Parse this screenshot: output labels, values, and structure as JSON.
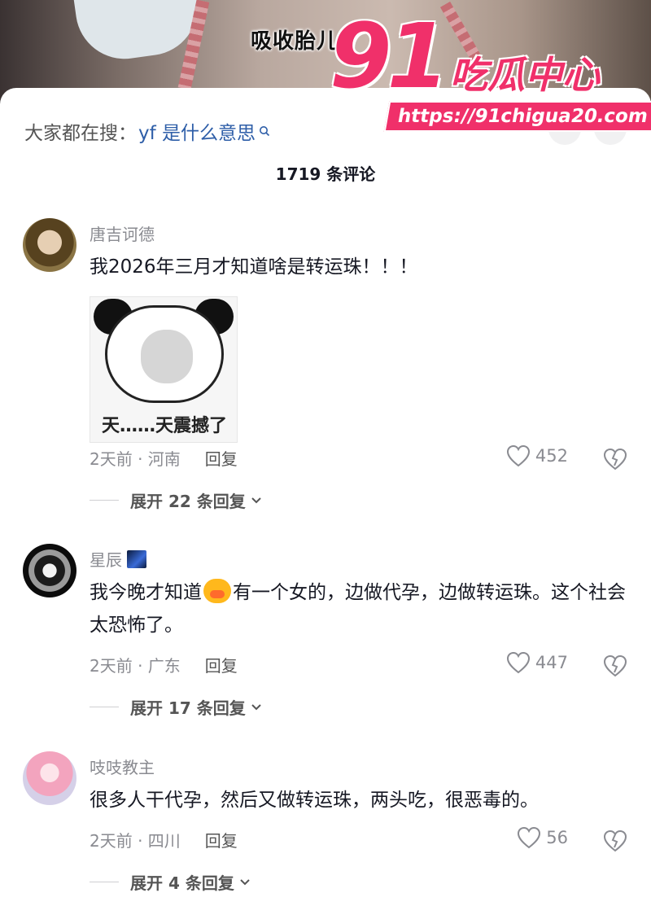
{
  "video": {
    "subtitle": "吸收胎儿"
  },
  "search_hint": {
    "prefix": "大家都在搜：",
    "query": "yf 是什么意思"
  },
  "comment_count": "1719 条评论",
  "watermark": {
    "brand": "91",
    "name": "吃瓜中心",
    "url": "https://91chigua20.com"
  },
  "comments": [
    {
      "username": "唐吉诃德",
      "text": "我2026年三月才知道啥是转运珠！！！",
      "sticker_caption": "天……天震撼了",
      "time_location": "2天前 · 河南",
      "reply_label": "回复",
      "likes": "452",
      "expand": "展开 22 条回复"
    },
    {
      "username": "星辰",
      "text_before": "我今晚才知道",
      "text_after": "有一个女的，边做代孕，边做转运珠。这个社会太恐怖了。",
      "time_location": "2天前 · 广东",
      "reply_label": "回复",
      "likes": "447",
      "expand": "展开 17 条回复"
    },
    {
      "username": "吱吱教主",
      "text": "很多人干代孕，然后又做转运珠，两头吃，很恶毒的。",
      "time_location": "2天前 · 四川",
      "reply_label": "回复",
      "likes": "56",
      "expand": "展开 4 条回复"
    }
  ]
}
